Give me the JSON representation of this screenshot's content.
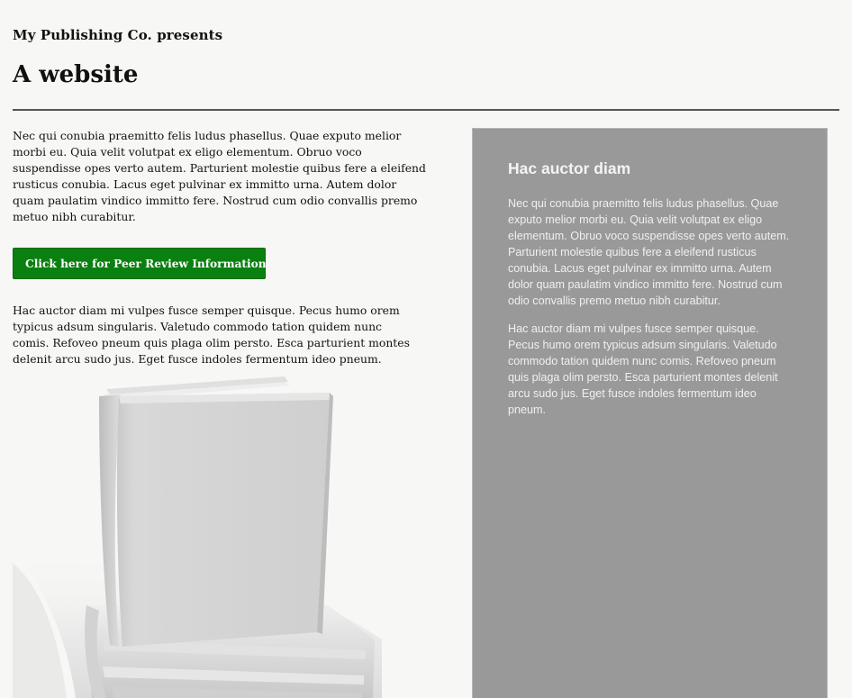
{
  "header": {
    "presents": "My Publishing Co. presents",
    "title": "A website"
  },
  "main": {
    "intro": "Nec qui conubia praemitto felis ludus phasellus. Quae exputo melior morbi eu. Quia velit volutpat ex eligo elementum. Obruo voco suspendisse opes verto autem. Parturient molestie quibus fere a eleifend rusticus conubia. Lacus eget pulvinar ex immitto urna. Autem dolor quam paulatim vindico immitto fere. Nostrud cum odio convallis premo metuo nibh curabitur.",
    "cta_label": "Click here for Peer Review Information",
    "body": "Hac auctor diam mi vulpes fusce semper quisque. Pecus humo orem typicus adsum singularis. Valetudo commodo tation quidem nunc comis. Refoveo pneum quis plaga olim persto. Esca parturient montes delenit arcu sudo jus. Eget fusce indoles fermentum ideo pneum."
  },
  "aside": {
    "heading": "Hac auctor diam",
    "paragraphs": [
      "Nec qui conubia praemitto felis ludus phasellus. Quae exputo melior morbi eu. Quia velit volutpat ex eligo elementum. Obruo voco suspendisse opes verto autem. Parturient molestie quibus fere a eleifend rusticus conubia. Lacus eget pulvinar ex immitto urna. Autem dolor quam paulatim vindico immitto fere. Nostrud cum odio convallis premo metuo nibh curabitur.",
      "Hac auctor diam mi vulpes fusce semper quisque. Pecus humo orem typicus adsum singularis. Valetudo commodo tation quidem nunc comis. Refoveo pneum quis plaga olim persto. Esca parturient montes delenit arcu sudo jus. Eget fusce indoles fermentum ideo pneum."
    ]
  },
  "colors": {
    "page_background": "#f7f7f5",
    "cta_background": "#0a8010",
    "aside_background": "#999999",
    "divider": "#555555"
  },
  "icons": {
    "hero_image": "book-stack-illustration"
  }
}
